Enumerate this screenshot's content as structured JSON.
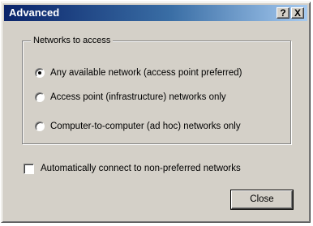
{
  "window": {
    "title": "Advanced",
    "help_button_label": "?",
    "close_button_label": "X"
  },
  "networks_group": {
    "legend": "Networks to access",
    "options": [
      {
        "label": "Any available network (access point preferred)",
        "selected": true
      },
      {
        "label": "Access point (infrastructure) networks only",
        "selected": false
      },
      {
        "label": "Computer-to-computer (ad hoc) networks only",
        "selected": false
      }
    ]
  },
  "auto_connect": {
    "label": "Automatically connect to non-preferred networks",
    "checked": false
  },
  "buttons": {
    "close_label": "Close"
  },
  "colors": {
    "face": "#d4d0c8",
    "title_active_start": "#0a246a",
    "title_active_end": "#a6caf0"
  }
}
